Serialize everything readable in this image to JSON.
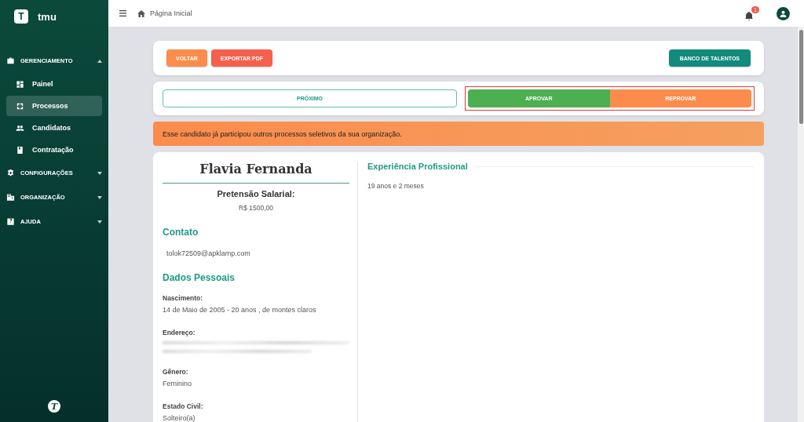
{
  "brand": {
    "initial": "T",
    "name": "tmu"
  },
  "footer_logo": "T",
  "sidebar": {
    "sections": [
      {
        "label": "GERENCIAMENTO",
        "expanded": true,
        "kind": "briefcase",
        "children": [
          {
            "label": "Painel",
            "selected": false,
            "kind": "dashboard"
          },
          {
            "label": "Processos",
            "selected": true,
            "kind": "cycle"
          },
          {
            "label": "Candidatos",
            "selected": false,
            "kind": "people"
          },
          {
            "label": "Contratação",
            "selected": false,
            "kind": "book"
          }
        ]
      },
      {
        "label": "CONFIGURAÇÕES",
        "expanded": false,
        "kind": "gear"
      },
      {
        "label": "ORGANIZAÇÃO",
        "expanded": false,
        "kind": "building"
      },
      {
        "label": "AJUDA",
        "expanded": false,
        "kind": "help"
      }
    ]
  },
  "topbar": {
    "breadcrumb": "Página Inicial",
    "notifications": "1"
  },
  "actions": {
    "left": [
      {
        "label": "VOLTAR",
        "color": "#fb8c4c"
      },
      {
        "label": "EXPORTAR PDF",
        "color": "#f4604c"
      }
    ],
    "right": "BANCO DE TALENTOS"
  },
  "decision": {
    "next": "PRÓXIMO",
    "approve": "APROVAR",
    "reject": "REPROVAR"
  },
  "alert": "Esse candidato já participou outros processos seletivos da sua organização.",
  "profile": {
    "name": "Flavia Fernanda",
    "salary_label": "Pretensão Salarial:",
    "salary": "R$ 1500,00",
    "contact_title": "Contato",
    "email": "tolok72509@apklamp.com",
    "personal_title": "Dados Pessoais",
    "fields": [
      {
        "label": "Nascimento:",
        "value": "14 de Maio de 2005 - 20 anos , de montes claros",
        "kind": "text"
      },
      {
        "label": "Endereço:",
        "kind": "blurred"
      },
      {
        "label": "Gênero:",
        "value": "Feminino",
        "kind": "text"
      },
      {
        "label": "Estado Civil:",
        "value": "Solteiro(a)",
        "kind": "text"
      }
    ]
  },
  "experience": {
    "title": "Experiência Profissional",
    "value": "19 anos e 2 meses"
  }
}
